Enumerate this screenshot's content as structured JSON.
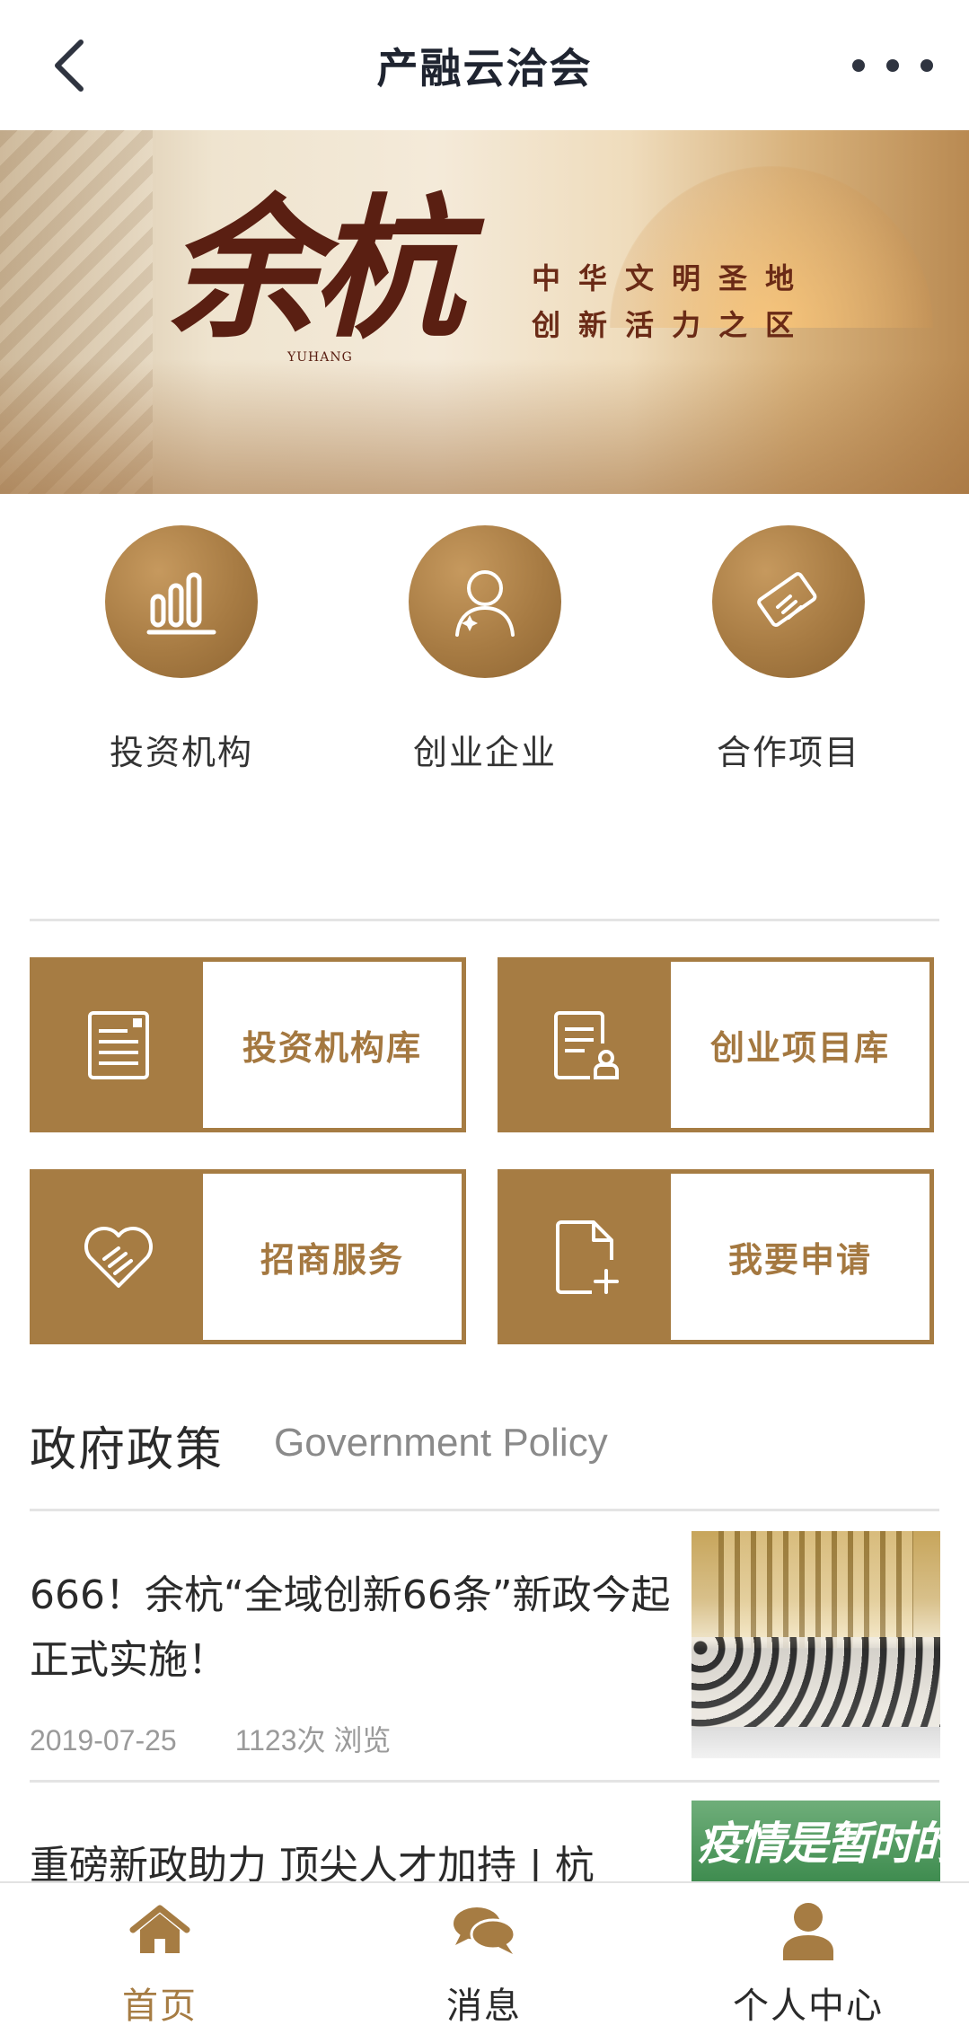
{
  "header": {
    "title": "产融云洽会",
    "back_icon": "chevron-left-icon",
    "more_icon": "more-dots-icon"
  },
  "banner": {
    "calligraphy": "余杭",
    "calligraphy_en": "YUHANG",
    "slogan_line1": "中华文明圣地",
    "slogan_line2": "创新活力之区"
  },
  "quick_nav": [
    {
      "label": "投资机构",
      "icon": "bar-chart-icon"
    },
    {
      "label": "创业企业",
      "icon": "user-icon"
    },
    {
      "label": "合作项目",
      "icon": "handshake-icon"
    }
  ],
  "tiles": [
    {
      "label": "投资机构库",
      "icon": "document-icon"
    },
    {
      "label": "创业项目库",
      "icon": "document-person-icon"
    },
    {
      "label": "招商服务",
      "icon": "heart-handshake-icon"
    },
    {
      "label": "我要申请",
      "icon": "file-add-icon"
    }
  ],
  "policy_section": {
    "title": "政府政策",
    "subtitle": "Government Policy"
  },
  "news": [
    {
      "title": "666！余杭“全域创新66条”新政今起正式实施！",
      "date": "2019-07-25",
      "views": "1123次 浏览"
    },
    {
      "title": "重磅新政助力 顶尖人才加持 | 杭",
      "thumb_text": "疫情是暂时的"
    }
  ],
  "tabbar": [
    {
      "label": "首页",
      "icon": "home-icon",
      "active": true
    },
    {
      "label": "消息",
      "icon": "chat-bubbles-icon",
      "active": false
    },
    {
      "label": "个人中心",
      "icon": "person-icon",
      "active": false
    }
  ],
  "colors": {
    "accent": "#a67c43",
    "text": "#2a2a2a",
    "muted": "#9a9a9a"
  }
}
